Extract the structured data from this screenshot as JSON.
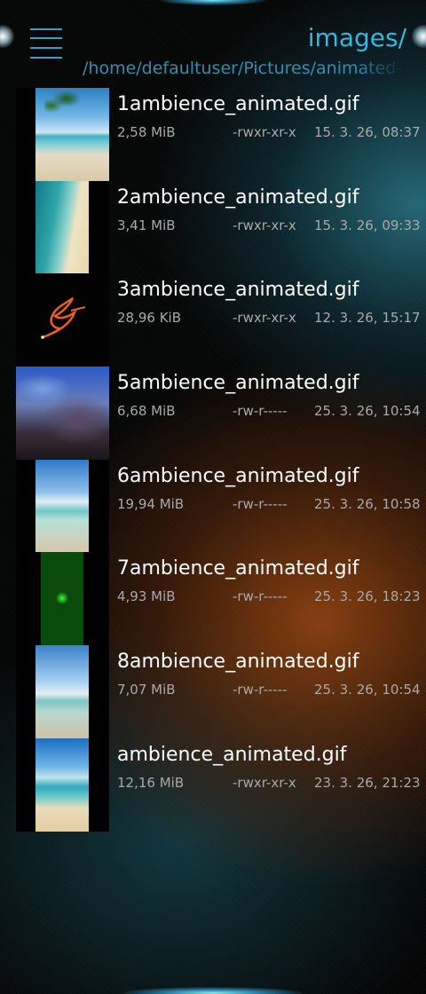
{
  "header": {
    "title": "images/",
    "path": "/home/defaultuser/Pictures/animated-ambience"
  },
  "files": [
    {
      "name": "1ambience_animated.gif",
      "size": "2,58 MiB",
      "permissions": "-rwxr-xr-x",
      "modified": "15. 3. 26, 08:37",
      "thumbnail": "tropical-beach-palm"
    },
    {
      "name": "2ambience_animated.gif",
      "size": "3,41 MiB",
      "permissions": "-rwxr-xr-x",
      "modified": "15. 3. 26, 09:33",
      "thumbnail": "ocean-shore-aerial"
    },
    {
      "name": "3ambience_animated.gif",
      "size": "28,96 KiB",
      "permissions": "-rwxr-xr-x",
      "modified": "12. 3. 26, 15:17",
      "thumbnail": "orange-swordfish-logo"
    },
    {
      "name": "5ambience_animated.gif",
      "size": "6,68 MiB",
      "permissions": "-rw-r-----",
      "modified": "25. 3. 26, 10:54",
      "thumbnail": "aquarium-coral"
    },
    {
      "name": "6ambience_animated.gif",
      "size": "19,94 MiB",
      "permissions": "-rw-r-----",
      "modified": "25. 3. 26, 10:58",
      "thumbnail": "beach-waves"
    },
    {
      "name": "7ambience_animated.gif",
      "size": "4,93 MiB",
      "permissions": "-rw-r-----",
      "modified": "25. 3. 26, 18:23",
      "thumbnail": "circuit-board"
    },
    {
      "name": "8ambience_animated.gif",
      "size": "7,07 MiB",
      "permissions": "-rw-r-----",
      "modified": "25. 3. 26, 10:54",
      "thumbnail": "palm-beach"
    },
    {
      "name": "ambience_animated.gif",
      "size": "12,16 MiB",
      "permissions": "-rwxr-xr-x",
      "modified": "23. 3. 26, 21:23",
      "thumbnail": "lagoon-beach"
    }
  ],
  "colors": {
    "accent": "#35b8e0",
    "path": "#2f8fb3",
    "text": "#ffffff",
    "secondary_text": "#a9a9a9"
  }
}
